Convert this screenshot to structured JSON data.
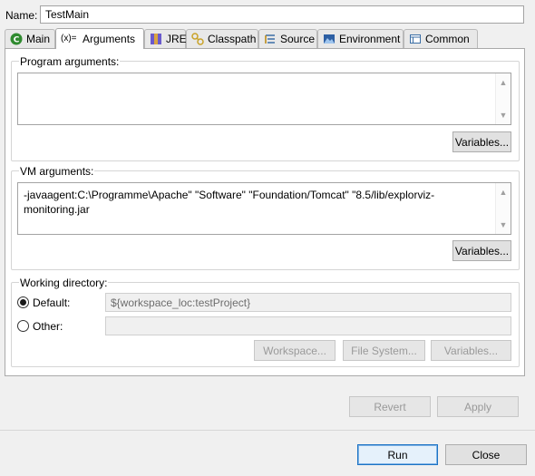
{
  "name": {
    "label": "Name:",
    "value": "TestMain"
  },
  "tabs": [
    {
      "label": "Main",
      "icon": "main-icon"
    },
    {
      "label": "Arguments",
      "icon": "arguments-icon",
      "active": true
    },
    {
      "label": "JRE",
      "icon": "jre-icon"
    },
    {
      "label": "Classpath",
      "icon": "classpath-icon"
    },
    {
      "label": "Source",
      "icon": "source-icon"
    },
    {
      "label": "Environment",
      "icon": "environment-icon"
    },
    {
      "label": "Common",
      "icon": "common-icon"
    }
  ],
  "program_args": {
    "title": "Program arguments:",
    "value": "",
    "variables_label": "Variables..."
  },
  "vm_args": {
    "title": "VM arguments:",
    "value_line1": "-javaagent:C:\\Programme\\Apache\" \"Software\" \"Foundation/Tomcat\" \"8.5/lib/explorviz-",
    "value_line2": "monitoring.jar",
    "variables_label": "Variables..."
  },
  "working_dir": {
    "title": "Working directory:",
    "default_label": "Default:",
    "default_value": "${workspace_loc:testProject}",
    "default_selected": true,
    "other_label": "Other:",
    "other_value": "",
    "workspace_label": "Workspace...",
    "filesystem_label": "File System...",
    "variables_label": "Variables..."
  },
  "footer": {
    "revert_label": "Revert",
    "apply_label": "Apply",
    "run_label": "Run",
    "close_label": "Close"
  },
  "colors": {
    "accent": "#1c73c4",
    "main_icon": "#2f8a2f",
    "disabled_text": "#9a9a9a"
  }
}
